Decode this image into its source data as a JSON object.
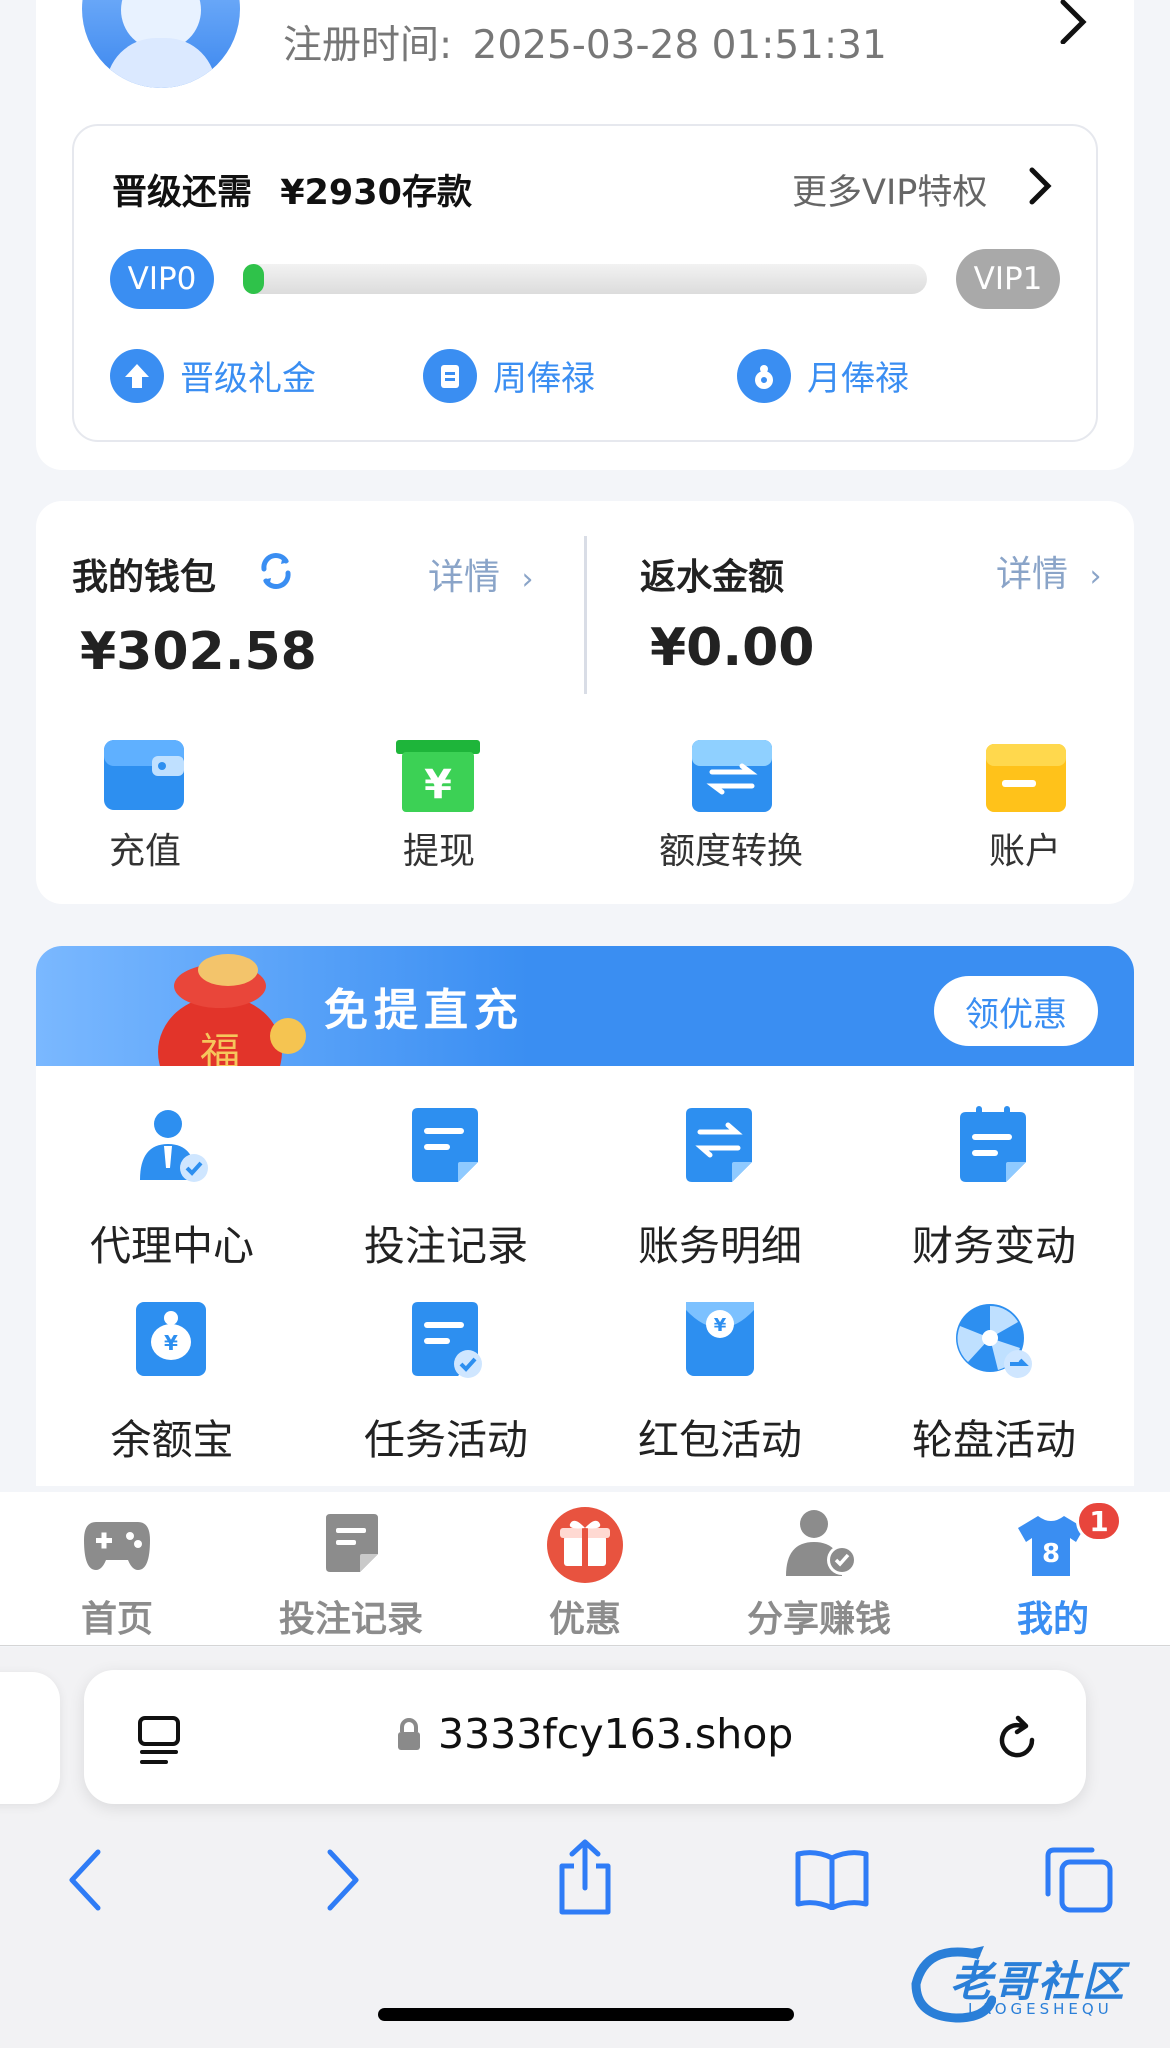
{
  "profile": {
    "reg_label": "注册时间:",
    "reg_time": "2025-03-28 01:51:31"
  },
  "vip": {
    "upgrade_prefix": "晋级还需",
    "upgrade_amount": "¥2930存款",
    "more_link": "更多VIP特权",
    "current_level": "VIP0",
    "next_level": "VIP1",
    "progress_fraction": 0.02,
    "perks": [
      {
        "label": "晋级礼金",
        "icon": "upgrade-arrow-icon"
      },
      {
        "label": "周俸禄",
        "icon": "clipboard-icon"
      },
      {
        "label": "月俸禄",
        "icon": "money-bag-icon"
      }
    ]
  },
  "wallet": {
    "title": "我的钱包",
    "detail": "详情",
    "amount": "¥302.58",
    "rebate_title": "返水金额",
    "rebate_detail": "详情",
    "rebate_amount": "¥0.00",
    "actions": [
      {
        "label": "充值",
        "icon": "wallet-icon"
      },
      {
        "label": "提现",
        "icon": "yuan-box-icon"
      },
      {
        "label": "额度转换",
        "icon": "transfer-icon"
      },
      {
        "label": "账户",
        "icon": "card-icon"
      }
    ]
  },
  "promo": {
    "title": "免提直充",
    "button": "领优惠"
  },
  "menu": [
    {
      "label": "代理中心",
      "icon": "agent-icon"
    },
    {
      "label": "投注记录",
      "icon": "bet-record-icon"
    },
    {
      "label": "账务明细",
      "icon": "account-detail-icon"
    },
    {
      "label": "财务变动",
      "icon": "finance-change-icon"
    },
    {
      "label": "余额宝",
      "icon": "balance-bag-icon"
    },
    {
      "label": "任务活动",
      "icon": "task-icon"
    },
    {
      "label": "红包活动",
      "icon": "red-packet-icon"
    },
    {
      "label": "轮盘活动",
      "icon": "wheel-icon"
    }
  ],
  "tabbar": {
    "items": [
      {
        "label": "首页",
        "icon": "gamepad-icon"
      },
      {
        "label": "投注记录",
        "icon": "document-icon"
      },
      {
        "label": "优惠",
        "icon": "gift-icon"
      },
      {
        "label": "分享赚钱",
        "icon": "share-user-icon"
      },
      {
        "label": "我的",
        "icon": "shirt-icon"
      }
    ],
    "badge": "1",
    "active_color": "#3a8ef2"
  },
  "browser": {
    "url": "3333fcy163.shop"
  },
  "watermark": {
    "text": "老哥社区",
    "sub": "LAOGESHEQU"
  }
}
